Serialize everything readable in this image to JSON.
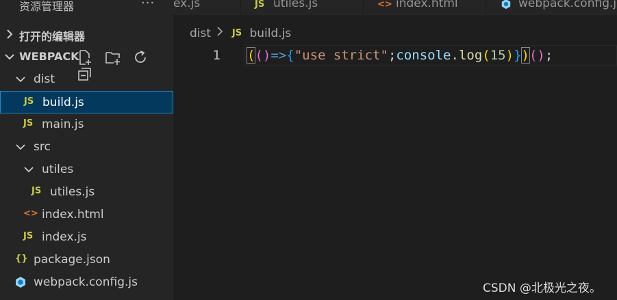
{
  "sidebar": {
    "title": "资源管理器",
    "more": "···",
    "open_editors": "打开的编辑器",
    "project": "WEBPACK",
    "tree": [
      {
        "label": "dist",
        "type": "folder"
      },
      {
        "label": "build.js",
        "type": "js",
        "badge": "JS"
      },
      {
        "label": "main.js",
        "type": "js",
        "badge": "JS"
      },
      {
        "label": "src",
        "type": "folder"
      },
      {
        "label": "utiles",
        "type": "folder"
      },
      {
        "label": "utiles.js",
        "type": "js",
        "badge": "JS"
      },
      {
        "label": "index.html",
        "type": "html",
        "badge": "<>"
      },
      {
        "label": "index.js",
        "type": "js",
        "badge": "JS"
      },
      {
        "label": "package.json",
        "type": "json",
        "badge": "{}"
      },
      {
        "label": "webpack.config.js",
        "type": "webpack"
      }
    ]
  },
  "tabs": [
    {
      "label": "ex.js"
    },
    {
      "label": "utiles.js",
      "badge": "JS"
    },
    {
      "label": "index.html",
      "badge": "<>"
    },
    {
      "label": "webpack.config.j"
    }
  ],
  "breadcrumb": {
    "folder": "dist",
    "file": "build.js",
    "badge": "JS"
  },
  "editor": {
    "line_number": "1",
    "code": [
      {
        "t": "(",
        "c": "#ffd700"
      },
      {
        "t": "()",
        "c": "#da70d6"
      },
      {
        "t": "=>",
        "c": "#569cd6"
      },
      {
        "t": "{",
        "c": "#179fff"
      },
      {
        "t": "\"use strict\"",
        "c": "#ce9178"
      },
      {
        "t": ";",
        "c": "#d4d4d4"
      },
      {
        "t": "console",
        "c": "#9cdcfe"
      },
      {
        "t": ".",
        "c": "#d4d4d4"
      },
      {
        "t": "log",
        "c": "#dcdcaa"
      },
      {
        "t": "(",
        "c": "#ffd700"
      },
      {
        "t": "15",
        "c": "#b5cea8"
      },
      {
        "t": ")",
        "c": "#ffd700"
      },
      {
        "t": "}",
        "c": "#179fff"
      },
      {
        "t": ")",
        "c": "#ffd700"
      },
      {
        "t": "()",
        "c": "#da70d6"
      },
      {
        "t": ";",
        "c": "#d4d4d4"
      }
    ]
  },
  "watermark": "CSDN @北极光之夜。",
  "colors": {
    "selection_bg": "#04395e",
    "selection_border": "#1f88d2",
    "js_badge": "#cbcb41",
    "html_badge": "#e37933",
    "webpack_icon": "#8ed6fb"
  }
}
